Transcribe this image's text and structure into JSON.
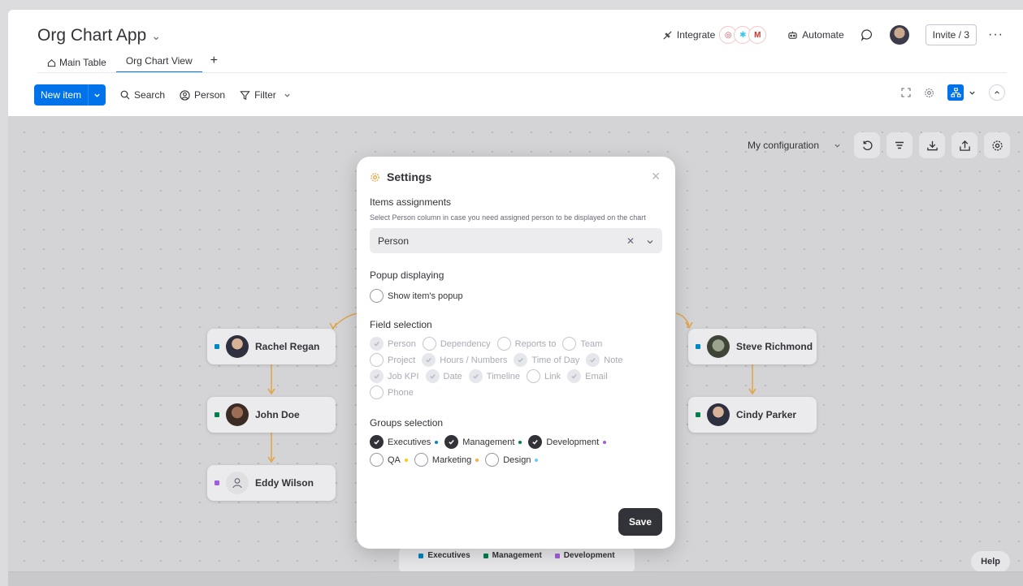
{
  "board": {
    "title": "Org Chart App"
  },
  "tabs": [
    {
      "label": "Main Table",
      "icon": "home-icon"
    },
    {
      "label": "Org Chart View"
    }
  ],
  "top_right": {
    "integrate_label": "Integrate",
    "automate_label": "Automate",
    "invite_label": "Invite / 3",
    "more_label": "···"
  },
  "toolbar": {
    "new_item_label": "New item",
    "search_label": "Search",
    "person_label": "Person",
    "filter_label": "Filter"
  },
  "canvas": {
    "config_label": "My configuration",
    "help_label": "Help"
  },
  "nodes": [
    {
      "name": "Rachel Regan",
      "group_color": "#0086c0"
    },
    {
      "name": "John Doe",
      "group_color": "#037f4c"
    },
    {
      "name": "Eddy Wilson",
      "group_color": "#a25ddc"
    },
    {
      "name": "Steve Richmond",
      "group_color": "#0086c0"
    },
    {
      "name": "Cindy Parker",
      "group_color": "#037f4c"
    }
  ],
  "legend": [
    {
      "label": "Executives",
      "color": "#0086c0"
    },
    {
      "label": "Management",
      "color": "#037f4c"
    },
    {
      "label": "Development",
      "color": "#a25ddc"
    }
  ],
  "settings": {
    "title": "Settings",
    "items_assignments_label": "Items assignments",
    "items_assignments_desc": "Select Person column in case you need assigned person to be displayed on the chart",
    "person_select_value": "Person",
    "popup_label": "Popup displaying",
    "show_popup_label": "Show item's popup",
    "field_selection_label": "Field selection",
    "fields": [
      {
        "label": "Person",
        "checked": true
      },
      {
        "label": "Dependency",
        "checked": false
      },
      {
        "label": "Reports to",
        "checked": false
      },
      {
        "label": "Team",
        "checked": false
      },
      {
        "label": "Project",
        "checked": false
      },
      {
        "label": "Hours / Numbers",
        "checked": true
      },
      {
        "label": "Time of Day",
        "checked": true
      },
      {
        "label": "Note",
        "checked": true
      },
      {
        "label": "Job KPI",
        "checked": true
      },
      {
        "label": "Date",
        "checked": true
      },
      {
        "label": "Timeline",
        "checked": true
      },
      {
        "label": "Link",
        "checked": false
      },
      {
        "label": "Email",
        "checked": true
      },
      {
        "label": "Phone",
        "checked": false
      }
    ],
    "groups_selection_label": "Groups selection",
    "groups": [
      {
        "label": "Executives",
        "checked": true,
        "color": "#0086c0"
      },
      {
        "label": "Management",
        "checked": true,
        "color": "#037f4c"
      },
      {
        "label": "Development",
        "checked": true,
        "color": "#a25ddc"
      },
      {
        "label": "QA",
        "checked": false,
        "color": "#ffcb00"
      },
      {
        "label": "Marketing",
        "checked": false,
        "color": "#fdab3d"
      },
      {
        "label": "Design",
        "checked": false,
        "color": "#66ccff"
      }
    ],
    "save_label": "Save"
  }
}
